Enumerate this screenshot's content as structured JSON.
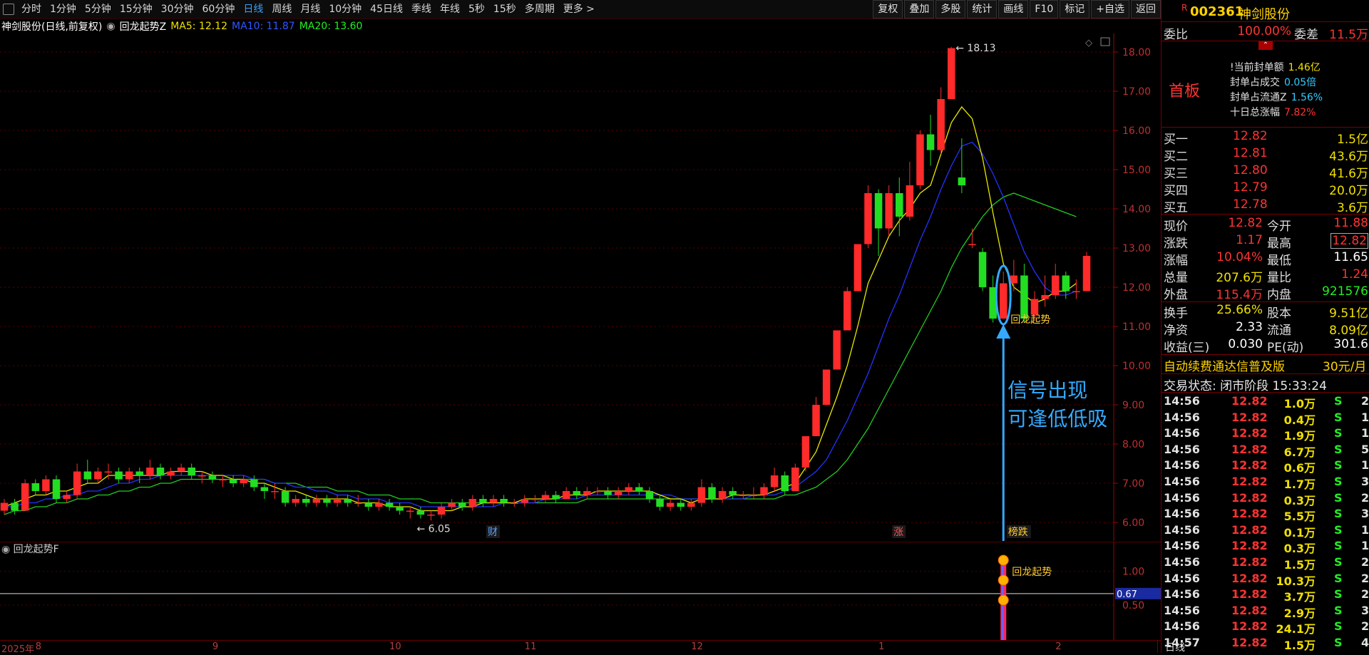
{
  "toolbar": {
    "periods": [
      "分时",
      "1分钟",
      "5分钟",
      "15分钟",
      "30分钟",
      "60分钟",
      "日线",
      "周线",
      "月线",
      "10分钟",
      "45日线",
      "季线",
      "年线",
      "5秒",
      "15秒",
      "多周期",
      "更多 >"
    ],
    "active_period": "日线",
    "tools": [
      "复权",
      "叠加",
      "多股",
      "统计",
      "画线",
      "F10",
      "标记",
      "+自选",
      "返回"
    ]
  },
  "chart_header": {
    "title": "神剑股份(日线,前复权)",
    "indicator": "回龙起势Z",
    "ma5": "MA5: 12.12",
    "ma10": "MA10: 11.87",
    "ma20": "MA20: 13.60"
  },
  "colors": {
    "up": "#ff2a2a",
    "down": "#22dd22",
    "ma5": "#e8e800",
    "ma10": "#2233ff",
    "ma20": "#22cc22",
    "signal": "#33aaff",
    "grid": "#5a0000"
  },
  "chart_data": {
    "type": "candlestick",
    "ylim": [
      5.6,
      18.4
    ],
    "yticks": [
      "18.00",
      "17.00",
      "16.00",
      "15.00",
      "14.00",
      "13.00",
      "12.00",
      "11.00",
      "10.00",
      "9.00",
      "8.00",
      "7.00",
      "6.00"
    ],
    "high_label": "18.13",
    "low_label": "6.05",
    "candles": [
      [
        6.3,
        6.5,
        6.2,
        6.6
      ],
      [
        6.5,
        6.3,
        6.2,
        6.6
      ],
      [
        6.3,
        7.0,
        6.3,
        7.1
      ],
      [
        7.0,
        6.8,
        6.7,
        7.1
      ],
      [
        6.8,
        7.1,
        6.7,
        7.2
      ],
      [
        7.1,
        6.6,
        6.5,
        7.2
      ],
      [
        6.6,
        6.7,
        6.5,
        6.8
      ],
      [
        6.7,
        7.3,
        6.6,
        7.5
      ],
      [
        7.3,
        7.1,
        7.0,
        7.6
      ],
      [
        7.1,
        7.3,
        7.0,
        7.4
      ],
      [
        7.3,
        7.3,
        7.1,
        7.5
      ],
      [
        7.3,
        7.1,
        7.0,
        7.4
      ],
      [
        7.1,
        7.3,
        7.0,
        7.4
      ],
      [
        7.3,
        7.2,
        7.0,
        7.4
      ],
      [
        7.2,
        7.4,
        7.1,
        7.6
      ],
      [
        7.4,
        7.2,
        7.1,
        7.5
      ],
      [
        7.2,
        7.3,
        7.1,
        7.4
      ],
      [
        7.3,
        7.4,
        7.2,
        7.5
      ],
      [
        7.4,
        7.2,
        7.1,
        7.5
      ],
      [
        7.2,
        7.2,
        7.0,
        7.3
      ],
      [
        7.2,
        7.1,
        7.0,
        7.3
      ],
      [
        7.1,
        7.1,
        6.9,
        7.2
      ],
      [
        7.1,
        7.0,
        6.9,
        7.2
      ],
      [
        7.0,
        7.1,
        6.9,
        7.2
      ],
      [
        7.1,
        6.9,
        6.8,
        7.2
      ],
      [
        6.9,
        6.8,
        6.6,
        7.0
      ],
      [
        6.8,
        6.8,
        6.6,
        7.0
      ],
      [
        6.8,
        6.5,
        6.4,
        6.9
      ],
      [
        6.5,
        6.6,
        6.4,
        6.7
      ],
      [
        6.6,
        6.5,
        6.4,
        6.7
      ],
      [
        6.5,
        6.6,
        6.4,
        6.7
      ],
      [
        6.6,
        6.5,
        6.4,
        6.7
      ],
      [
        6.5,
        6.6,
        6.4,
        6.7
      ],
      [
        6.6,
        6.5,
        6.4,
        6.7
      ],
      [
        6.5,
        6.5,
        6.4,
        6.7
      ],
      [
        6.5,
        6.4,
        6.3,
        6.6
      ],
      [
        6.4,
        6.5,
        6.3,
        6.6
      ],
      [
        6.5,
        6.4,
        6.3,
        6.6
      ],
      [
        6.4,
        6.3,
        6.2,
        6.5
      ],
      [
        6.3,
        6.3,
        6.1,
        6.4
      ],
      [
        6.3,
        6.2,
        6.1,
        6.4
      ],
      [
        6.2,
        6.2,
        6.05,
        6.3
      ],
      [
        6.2,
        6.4,
        6.1,
        6.5
      ],
      [
        6.4,
        6.5,
        6.3,
        6.6
      ],
      [
        6.5,
        6.4,
        6.3,
        6.6
      ],
      [
        6.4,
        6.6,
        6.3,
        6.7
      ],
      [
        6.6,
        6.5,
        6.4,
        6.7
      ],
      [
        6.5,
        6.6,
        6.4,
        6.7
      ],
      [
        6.6,
        6.5,
        6.4,
        6.7
      ],
      [
        6.5,
        6.5,
        6.4,
        6.6
      ],
      [
        6.5,
        6.6,
        6.4,
        6.7
      ],
      [
        6.6,
        6.6,
        6.5,
        6.7
      ],
      [
        6.6,
        6.7,
        6.5,
        6.8
      ],
      [
        6.7,
        6.6,
        6.5,
        6.8
      ],
      [
        6.6,
        6.8,
        6.6,
        6.9
      ],
      [
        6.8,
        6.7,
        6.6,
        6.9
      ],
      [
        6.7,
        6.8,
        6.6,
        6.9
      ],
      [
        6.8,
        6.8,
        6.7,
        6.9
      ],
      [
        6.8,
        6.7,
        6.6,
        6.9
      ],
      [
        6.7,
        6.8,
        6.6,
        6.9
      ],
      [
        6.8,
        6.9,
        6.7,
        7.0
      ],
      [
        6.9,
        6.8,
        6.7,
        7.0
      ],
      [
        6.8,
        6.6,
        6.5,
        6.9
      ],
      [
        6.6,
        6.4,
        6.3,
        6.7
      ],
      [
        6.4,
        6.5,
        6.3,
        6.6
      ],
      [
        6.5,
        6.4,
        6.3,
        6.6
      ],
      [
        6.4,
        6.5,
        6.3,
        6.6
      ],
      [
        6.5,
        6.9,
        6.4,
        7.1
      ],
      [
        6.9,
        6.6,
        6.5,
        7.0
      ],
      [
        6.6,
        6.8,
        6.5,
        6.9
      ],
      [
        6.8,
        6.7,
        6.6,
        6.9
      ],
      [
        6.7,
        6.7,
        6.6,
        6.8
      ],
      [
        6.7,
        6.7,
        6.6,
        6.9
      ],
      [
        6.7,
        6.9,
        6.6,
        7.0
      ],
      [
        6.9,
        7.2,
        6.8,
        7.4
      ],
      [
        7.2,
        6.8,
        6.7,
        7.3
      ],
      [
        6.8,
        7.4,
        6.8,
        7.5
      ],
      [
        7.4,
        8.2,
        7.3,
        8.2
      ],
      [
        8.2,
        9.0,
        8.2,
        9.2
      ],
      [
        9.0,
        9.9,
        9.0,
        9.9
      ],
      [
        9.9,
        10.9,
        9.9,
        10.9
      ],
      [
        10.9,
        11.9,
        10.9,
        12.0
      ],
      [
        11.9,
        13.1,
        11.9,
        13.1
      ],
      [
        13.1,
        14.4,
        13.0,
        14.6
      ],
      [
        14.4,
        13.5,
        12.8,
        14.5
      ],
      [
        13.5,
        14.4,
        13.3,
        14.6
      ],
      [
        14.4,
        13.8,
        13.3,
        14.8
      ],
      [
        13.8,
        14.6,
        13.7,
        15.2
      ],
      [
        14.6,
        15.9,
        14.5,
        16.0
      ],
      [
        15.9,
        15.5,
        15.1,
        16.4
      ],
      [
        15.5,
        16.8,
        15.4,
        17.1
      ],
      [
        16.8,
        18.1,
        16.8,
        18.13
      ],
      [
        14.8,
        14.6,
        14.4,
        15.8
      ],
      [
        13.1,
        13.1,
        13.0,
        13.5
      ],
      [
        12.9,
        12.0,
        11.9,
        13.0
      ],
      [
        12.0,
        11.2,
        11.1,
        12.3
      ],
      [
        11.2,
        12.1,
        11.2,
        12.4
      ],
      [
        12.1,
        12.3,
        11.9,
        12.7
      ],
      [
        12.3,
        11.2,
        11.1,
        12.6
      ],
      [
        11.3,
        11.7,
        11.2,
        11.9
      ],
      [
        11.7,
        11.8,
        11.5,
        12.3
      ],
      [
        11.8,
        12.3,
        11.7,
        12.6
      ],
      [
        12.3,
        11.9,
        11.7,
        12.4
      ],
      [
        11.9,
        11.9,
        11.7,
        12.2
      ],
      [
        11.9,
        12.8,
        11.9,
        12.9
      ]
    ],
    "ma5": [
      6.4,
      6.5,
      6.6,
      6.7,
      6.7,
      6.8,
      6.8,
      6.9,
      7.0,
      7.0,
      7.2,
      7.2,
      7.2,
      7.2,
      7.2,
      7.2,
      7.3,
      7.3,
      7.3,
      7.3,
      7.2,
      7.2,
      7.1,
      7.1,
      7.0,
      7.0,
      6.9,
      6.8,
      6.8,
      6.7,
      6.6,
      6.6,
      6.6,
      6.6,
      6.5,
      6.5,
      6.5,
      6.4,
      6.4,
      6.4,
      6.3,
      6.3,
      6.3,
      6.3,
      6.4,
      6.4,
      6.5,
      6.5,
      6.5,
      6.5,
      6.6,
      6.6,
      6.6,
      6.6,
      6.7,
      6.7,
      6.7,
      6.8,
      6.8,
      6.8,
      6.8,
      6.8,
      6.8,
      6.7,
      6.6,
      6.6,
      6.5,
      6.6,
      6.6,
      6.6,
      6.7,
      6.7,
      6.7,
      6.7,
      6.8,
      6.9,
      7.0,
      7.4,
      7.8,
      8.5,
      9.2,
      10.0,
      11.0,
      12.1,
      12.7,
      13.3,
      13.7,
      14.0,
      14.4,
      14.6,
      15.4,
      16.2,
      16.6,
      16.3,
      15.3,
      13.9,
      12.6,
      12.0,
      11.8,
      11.6,
      11.7,
      11.9,
      11.9,
      12.1
    ],
    "ma10": [
      6.4,
      6.4,
      6.5,
      6.5,
      6.6,
      6.6,
      6.7,
      6.7,
      6.8,
      6.8,
      6.9,
      7.0,
      7.0,
      7.1,
      7.1,
      7.2,
      7.2,
      7.2,
      7.2,
      7.2,
      7.2,
      7.2,
      7.2,
      7.2,
      7.1,
      7.1,
      7.0,
      7.0,
      6.9,
      6.9,
      6.8,
      6.8,
      6.7,
      6.7,
      6.6,
      6.6,
      6.6,
      6.5,
      6.5,
      6.5,
      6.4,
      6.4,
      6.4,
      6.4,
      6.4,
      6.4,
      6.4,
      6.4,
      6.5,
      6.5,
      6.5,
      6.5,
      6.6,
      6.6,
      6.6,
      6.6,
      6.7,
      6.7,
      6.7,
      6.7,
      6.7,
      6.7,
      6.7,
      6.7,
      6.7,
      6.6,
      6.6,
      6.6,
      6.6,
      6.6,
      6.6,
      6.6,
      6.7,
      6.7,
      6.7,
      6.8,
      6.9,
      7.1,
      7.3,
      7.6,
      8.1,
      8.6,
      9.2,
      9.8,
      10.5,
      11.2,
      11.8,
      12.5,
      13.2,
      13.8,
      14.5,
      15.1,
      15.6,
      15.7,
      15.4,
      14.9,
      14.3,
      13.6,
      12.9,
      12.4,
      12.0,
      11.8,
      11.8,
      11.9
    ],
    "ma20": [
      6.2,
      6.3,
      6.3,
      6.4,
      6.4,
      6.5,
      6.5,
      6.6,
      6.6,
      6.7,
      6.7,
      6.8,
      6.8,
      6.9,
      6.9,
      7.0,
      7.0,
      7.1,
      7.1,
      7.1,
      7.1,
      7.1,
      7.1,
      7.1,
      7.1,
      7.1,
      7.0,
      7.0,
      7.0,
      6.9,
      6.9,
      6.9,
      6.8,
      6.8,
      6.8,
      6.7,
      6.7,
      6.7,
      6.6,
      6.6,
      6.6,
      6.5,
      6.5,
      6.5,
      6.5,
      6.5,
      6.5,
      6.5,
      6.5,
      6.5,
      6.5,
      6.5,
      6.5,
      6.5,
      6.5,
      6.5,
      6.6,
      6.6,
      6.6,
      6.6,
      6.6,
      6.6,
      6.6,
      6.6,
      6.6,
      6.6,
      6.6,
      6.6,
      6.6,
      6.6,
      6.6,
      6.6,
      6.6,
      6.6,
      6.6,
      6.7,
      6.7,
      6.8,
      6.9,
      7.1,
      7.3,
      7.6,
      8.0,
      8.4,
      8.9,
      9.4,
      9.9,
      10.4,
      10.9,
      11.4,
      11.9,
      12.5,
      13.0,
      13.4,
      13.8,
      14.1,
      14.3,
      14.4,
      14.3,
      14.2,
      14.1,
      14.0,
      13.9,
      13.8
    ],
    "markers": [
      {
        "text": "财",
        "index": 47
      },
      {
        "text": "涨",
        "index": 86
      },
      {
        "text": "榜跌",
        "index": 97
      }
    ],
    "signal_label": "回龙起势",
    "signal_index": 96,
    "annotation_line1": "信号出现",
    "annotation_line2": "可逢低低吸",
    "sub_indicator": {
      "name": "回龙起势F",
      "yticks": [
        "1.00",
        "0.50"
      ],
      "current_value": "0.67",
      "ylim": [
        0,
        1.4
      ]
    },
    "x_labels": [
      {
        "text": "2025年",
        "index": 0
      },
      {
        "text": "8",
        "index": 3
      },
      {
        "text": "9",
        "index": 20
      },
      {
        "text": "10",
        "index": 37
      },
      {
        "text": "11",
        "index": 50
      },
      {
        "text": "12",
        "index": 66
      },
      {
        "text": "1",
        "index": 84
      },
      {
        "text": "2",
        "index": 101
      }
    ],
    "x_axis_mode": "日线"
  },
  "quote": {
    "flag": "R",
    "code": "002361",
    "name": "神剑股份",
    "weibi_label": "委比",
    "weibi": "100.00%",
    "weicha_label": "委差",
    "weicha": "11.5万",
    "board_label": "首板",
    "seal_lines": [
      {
        "label": "!当前封单额",
        "value": "1.46亿"
      },
      {
        "label": "封单占成交",
        "value": "0.05倍"
      },
      {
        "label": "封单占流通Z",
        "value": "1.56%"
      },
      {
        "label": "十日总涨幅",
        "value": "7.82%"
      }
    ],
    "bids": [
      {
        "label": "买一",
        "price": "12.82",
        "vol": "1.5亿"
      },
      {
        "label": "买二",
        "price": "12.81",
        "vol": "43.6万"
      },
      {
        "label": "买三",
        "price": "12.80",
        "vol": "41.6万"
      },
      {
        "label": "买四",
        "price": "12.79",
        "vol": "20.0万"
      },
      {
        "label": "买五",
        "price": "12.78",
        "vol": "3.6万"
      }
    ],
    "stats": [
      {
        "l1": "现价",
        "v1": "12.82",
        "l2": "今开",
        "v2": "11.88",
        "c1": "red",
        "c2": "red"
      },
      {
        "l1": "涨跌",
        "v1": "1.17",
        "l2": "最高",
        "v2": "12.82",
        "c1": "red",
        "c2": "red"
      },
      {
        "l1": "涨幅",
        "v1": "10.04%",
        "l2": "最低",
        "v2": "11.65",
        "c1": "red",
        "c2": "wht"
      },
      {
        "l1": "总量",
        "v1": "207.6万",
        "l2": "量比",
        "v2": "1.24",
        "c1": "yel",
        "c2": "red"
      },
      {
        "l1": "外盘",
        "v1": "115.4万",
        "l2": "内盘",
        "v2": "921576",
        "c1": "red",
        "c2": "grn"
      },
      {
        "l1": "换手",
        "v1": "25.66%",
        "l2": "股本",
        "v2": "9.51亿",
        "c1": "yel",
        "c2": "yel"
      },
      {
        "l1": "净资",
        "v1": "2.33",
        "l2": "流通",
        "v2": "8.09亿",
        "c1": "wht",
        "c2": "yel"
      },
      {
        "l1": "收益(三)",
        "v1": "0.030",
        "l2": "PE(动)",
        "v2": "301.6",
        "c1": "wht",
        "c2": "wht"
      }
    ],
    "ad_text": "自动续费通达信普及版",
    "ad_price": "30元/月",
    "trade_status": "交易状态: 闭市阶段 15:33:24",
    "ticks": [
      {
        "t": "14:56",
        "p": "12.82",
        "v": "1.0万",
        "s": "S",
        "n": "2"
      },
      {
        "t": "14:56",
        "p": "12.82",
        "v": "0.4万",
        "s": "S",
        "n": "1"
      },
      {
        "t": "14:56",
        "p": "12.82",
        "v": "1.9万",
        "s": "S",
        "n": "1"
      },
      {
        "t": "14:56",
        "p": "12.82",
        "v": "6.7万",
        "s": "S",
        "n": "5"
      },
      {
        "t": "14:56",
        "p": "12.82",
        "v": "0.6万",
        "s": "S",
        "n": "1"
      },
      {
        "t": "14:56",
        "p": "12.82",
        "v": "1.7万",
        "s": "S",
        "n": "3"
      },
      {
        "t": "14:56",
        "p": "12.82",
        "v": "0.3万",
        "s": "S",
        "n": "2"
      },
      {
        "t": "14:56",
        "p": "12.82",
        "v": "5.5万",
        "s": "S",
        "n": "3"
      },
      {
        "t": "14:56",
        "p": "12.82",
        "v": "0.1万",
        "s": "S",
        "n": "1"
      },
      {
        "t": "14:56",
        "p": "12.82",
        "v": "0.3万",
        "s": "S",
        "n": "1"
      },
      {
        "t": "14:56",
        "p": "12.82",
        "v": "1.5万",
        "s": "S",
        "n": "2"
      },
      {
        "t": "14:56",
        "p": "12.82",
        "v": "10.3万",
        "s": "S",
        "n": "2"
      },
      {
        "t": "14:56",
        "p": "12.82",
        "v": "3.7万",
        "s": "S",
        "n": "2"
      },
      {
        "t": "14:56",
        "p": "12.82",
        "v": "2.9万",
        "s": "S",
        "n": "3"
      },
      {
        "t": "14:56",
        "p": "12.82",
        "v": "24.1万",
        "s": "S",
        "n": "2"
      },
      {
        "t": "14:57",
        "p": "12.82",
        "v": "1.5万",
        "s": "S",
        "n": "4"
      }
    ]
  }
}
